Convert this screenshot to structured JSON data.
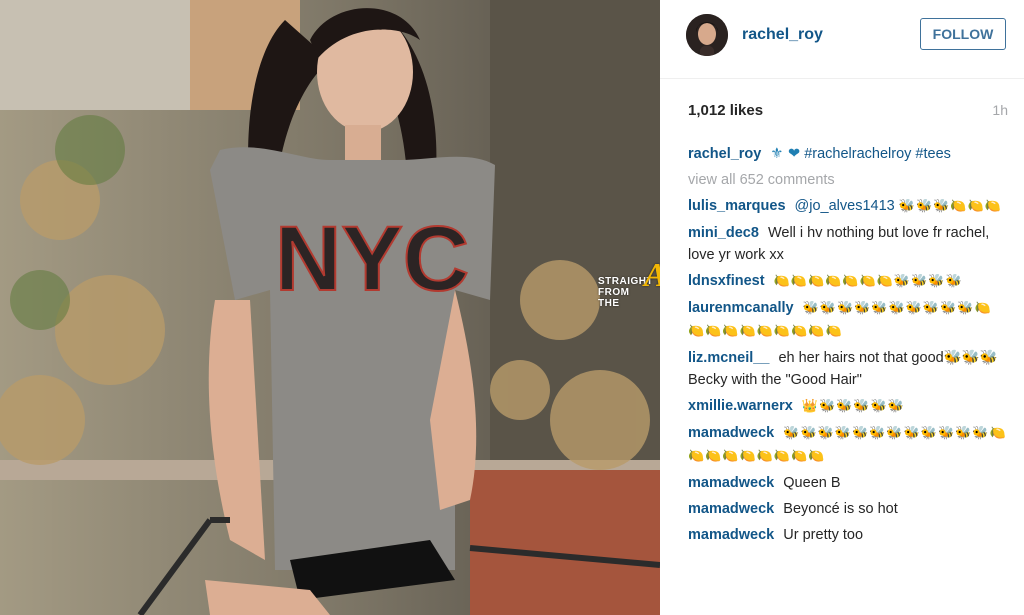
{
  "post": {
    "username": "rachel_roy",
    "follow_label": "FOLLOW",
    "likes": "1,012 likes",
    "time": "1h",
    "caption_user": "rachel_roy",
    "caption_icons": "⚜ ❤",
    "caption_tags": "#rachelrachelroy #tees",
    "view_all": "view all 652 comments",
    "watermark_line1": "STRAIGHT",
    "watermark_line2": "FROM",
    "watermark_line3": "THE",
    "watermark_letter": "A",
    "photo_print": "NYC"
  },
  "comments": [
    {
      "user": "lulis_marques",
      "mention": "@jo_alves1413",
      "text": "",
      "emoji": "🐝🐝🐝🍋🍋🍋"
    },
    {
      "user": "mini_dec8",
      "mention": "",
      "text": "Well i hv nothing but love fr rachel, love yr work xx",
      "emoji": ""
    },
    {
      "user": "ldnsxfinest",
      "mention": "",
      "text": "",
      "emoji": "🍋🍋🍋🍋🍋🍋🍋🐝🐝🐝🐝"
    },
    {
      "user": "laurenmcanally",
      "mention": "",
      "text": "",
      "emoji": "🐝🐝🐝🐝🐝🐝🐝🐝🐝🐝🍋🍋🍋🍋🍋🍋🍋🍋🍋🍋"
    },
    {
      "user": "liz.mcneil__",
      "mention": "",
      "text": "eh her hairs not that good🐝🐝🐝 Becky with the \"Good Hair\"",
      "emoji": ""
    },
    {
      "user": "xmillie.warnerx",
      "mention": "",
      "text": "",
      "emoji": "👑🐝🐝🐝🐝🐝"
    },
    {
      "user": "mamadweck",
      "mention": "",
      "text": "",
      "emoji": "🐝🐝🐝🐝🐝🐝🐝🐝🐝🐝🐝🐝🍋🍋🍋🍋🍋🍋🍋🍋🍋"
    },
    {
      "user": "mamadweck",
      "mention": "",
      "text": "Queen B",
      "emoji": ""
    },
    {
      "user": "mamadweck",
      "mention": "",
      "text": "Beyoncé is so hot",
      "emoji": ""
    },
    {
      "user": "mamadweck",
      "mention": "",
      "text": "Ur pretty too",
      "emoji": ""
    }
  ]
}
